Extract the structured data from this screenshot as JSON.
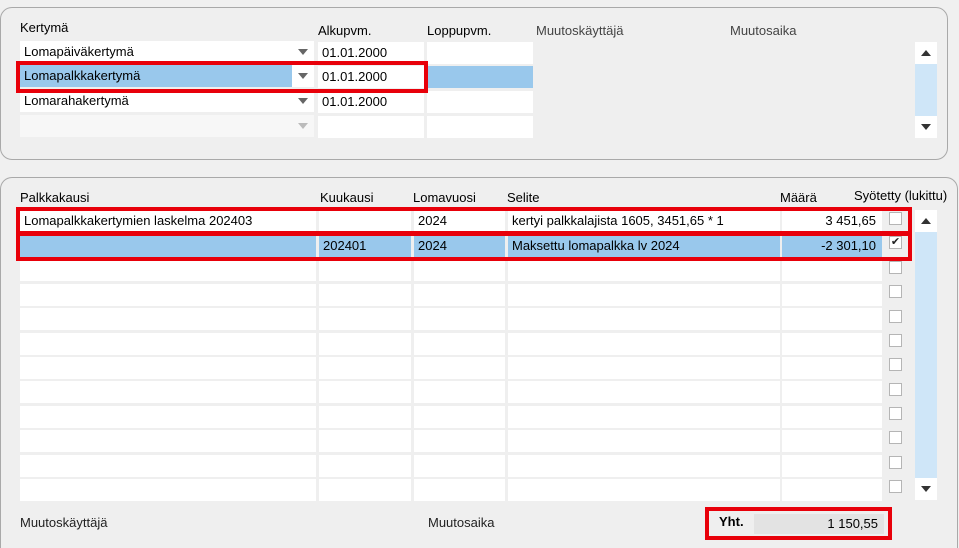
{
  "top": {
    "headers": {
      "kertyma": "Kertymä",
      "alkupvm": "Alkupvm.",
      "loppupvm": "Loppupvm.",
      "muutoskayttaja": "Muutoskäyttäjä",
      "muutosaika": "Muutosaika"
    },
    "rows": [
      {
        "kertyma": "Lomapäiväkertymä",
        "alkupvm": "01.01.2000",
        "loppupvm": ""
      },
      {
        "kertyma": "Lomapalkkakertymä",
        "alkupvm": "01.01.2000",
        "loppupvm": ""
      },
      {
        "kertyma": "Lomarahakertymä",
        "alkupvm": "01.01.2000",
        "loppupvm": ""
      },
      {
        "kertyma": "",
        "alkupvm": "",
        "loppupvm": ""
      }
    ],
    "selected_row": 1
  },
  "bottom": {
    "headers": {
      "palkkakausi": "Palkkakausi",
      "kuukausi": "Kuukausi",
      "lomavuosi": "Lomavuosi",
      "selite": "Selite",
      "maara": "Määrä",
      "syotetty": "Syötetty (lukittu)"
    },
    "rows": [
      {
        "palkkakausi": "Lomapalkkakertymien laskelma 202403",
        "kuukausi": "",
        "lomavuosi": "2024",
        "selite": "kertyi palkkalajista 1605, 3451,65 * 1",
        "maara": "3 451,65",
        "syotetty": false
      },
      {
        "palkkakausi": "",
        "kuukausi": "202401",
        "lomavuosi": "2024",
        "selite": "Maksettu lomapalkka lv 2024",
        "maara": "-2 301,10",
        "syotetty": true
      }
    ],
    "empty_rows": 10,
    "selected_row": 1
  },
  "footer": {
    "muutoskayttaja": "Muutoskäyttäjä",
    "muutosaika": "Muutosaika",
    "total_label": "Yht.",
    "total_value": "1 150,55"
  },
  "colors": {
    "selection": "#99c8ec",
    "highlight": "#e8000a",
    "scroll_track": "#cfe6f8"
  }
}
